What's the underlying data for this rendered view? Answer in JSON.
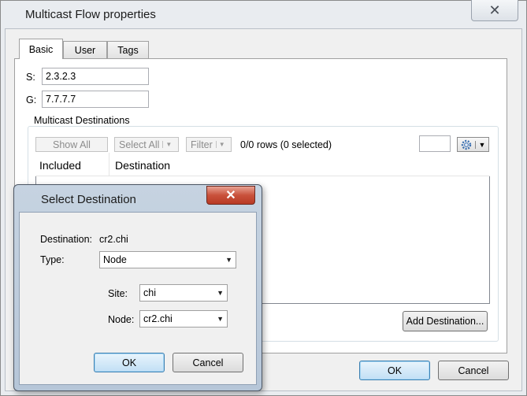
{
  "window": {
    "title": "Multicast Flow properties",
    "close_glyph": "✕"
  },
  "tabs": [
    {
      "label": "Basic",
      "active": true
    },
    {
      "label": "User",
      "active": false
    },
    {
      "label": "Tags",
      "active": false
    }
  ],
  "basic": {
    "s_label": "S:",
    "s_value": "2.3.2.3",
    "g_label": "G:",
    "g_value": "7.7.7.7"
  },
  "destinations": {
    "group_title": "Multicast Destinations",
    "show_all": "Show All",
    "select_all": "Select All",
    "filter": "Filter",
    "rows_status": "0/0 rows (0 selected)",
    "search_value": "",
    "columns": [
      "Included",
      "Destination"
    ],
    "rows": [],
    "add_button": "Add Destination..."
  },
  "main_buttons": {
    "ok": "OK",
    "cancel": "Cancel"
  },
  "dialog": {
    "title": "Select Destination",
    "close_glyph": "✕",
    "destination_label": "Destination:",
    "destination_value": "cr2.chi",
    "type_label": "Type:",
    "type_value": "Node",
    "site_label": "Site:",
    "site_value": "chi",
    "node_label": "Node:",
    "node_value": "cr2.chi",
    "ok": "OK",
    "cancel": "Cancel"
  },
  "icons": {
    "dropdown": "▼",
    "settings": "gear-icon"
  }
}
